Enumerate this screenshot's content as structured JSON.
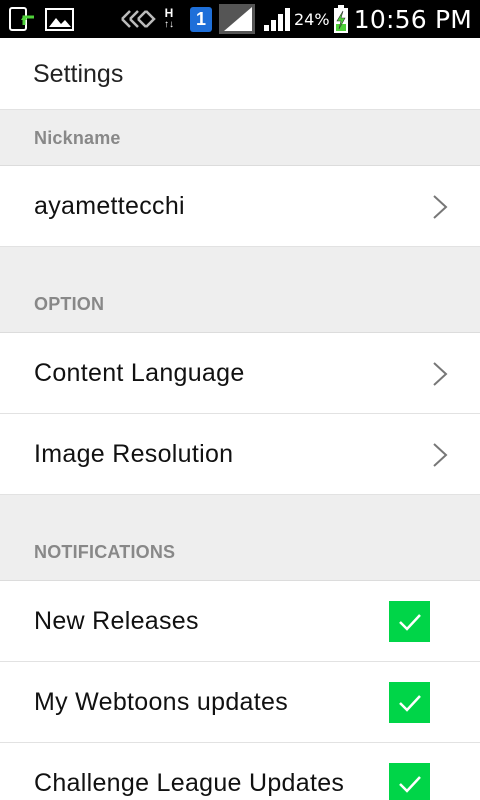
{
  "status_bar": {
    "icons": [
      "upload-icon",
      "image-icon",
      "wifi-off-icon",
      "h-network-icon",
      "one-badge-icon",
      "signal-icon-1",
      "signal-icon-2",
      "battery-charging-icon"
    ],
    "h_label": "H",
    "one_label": "1",
    "battery_percent": "24%",
    "time": "10:56 PM"
  },
  "header": {
    "title": "Settings"
  },
  "nickname_section": {
    "header": "Nickname",
    "value": "ayamettecchi"
  },
  "option_section": {
    "header": "OPTION",
    "items": [
      {
        "label": "Content Language"
      },
      {
        "label": "Image Resolution"
      }
    ]
  },
  "notifications_section": {
    "header": "NOTIFICATIONS",
    "items": [
      {
        "label": "New Releases",
        "checked": true
      },
      {
        "label": "My Webtoons updates",
        "checked": true
      },
      {
        "label": "Challenge League Updates",
        "checked": true
      }
    ]
  },
  "colors": {
    "status_bar_bg": "#000000",
    "section_bg": "#eeeeee",
    "checkbox_green": "#00d548",
    "one_badge_blue": "#1e6fd9"
  }
}
